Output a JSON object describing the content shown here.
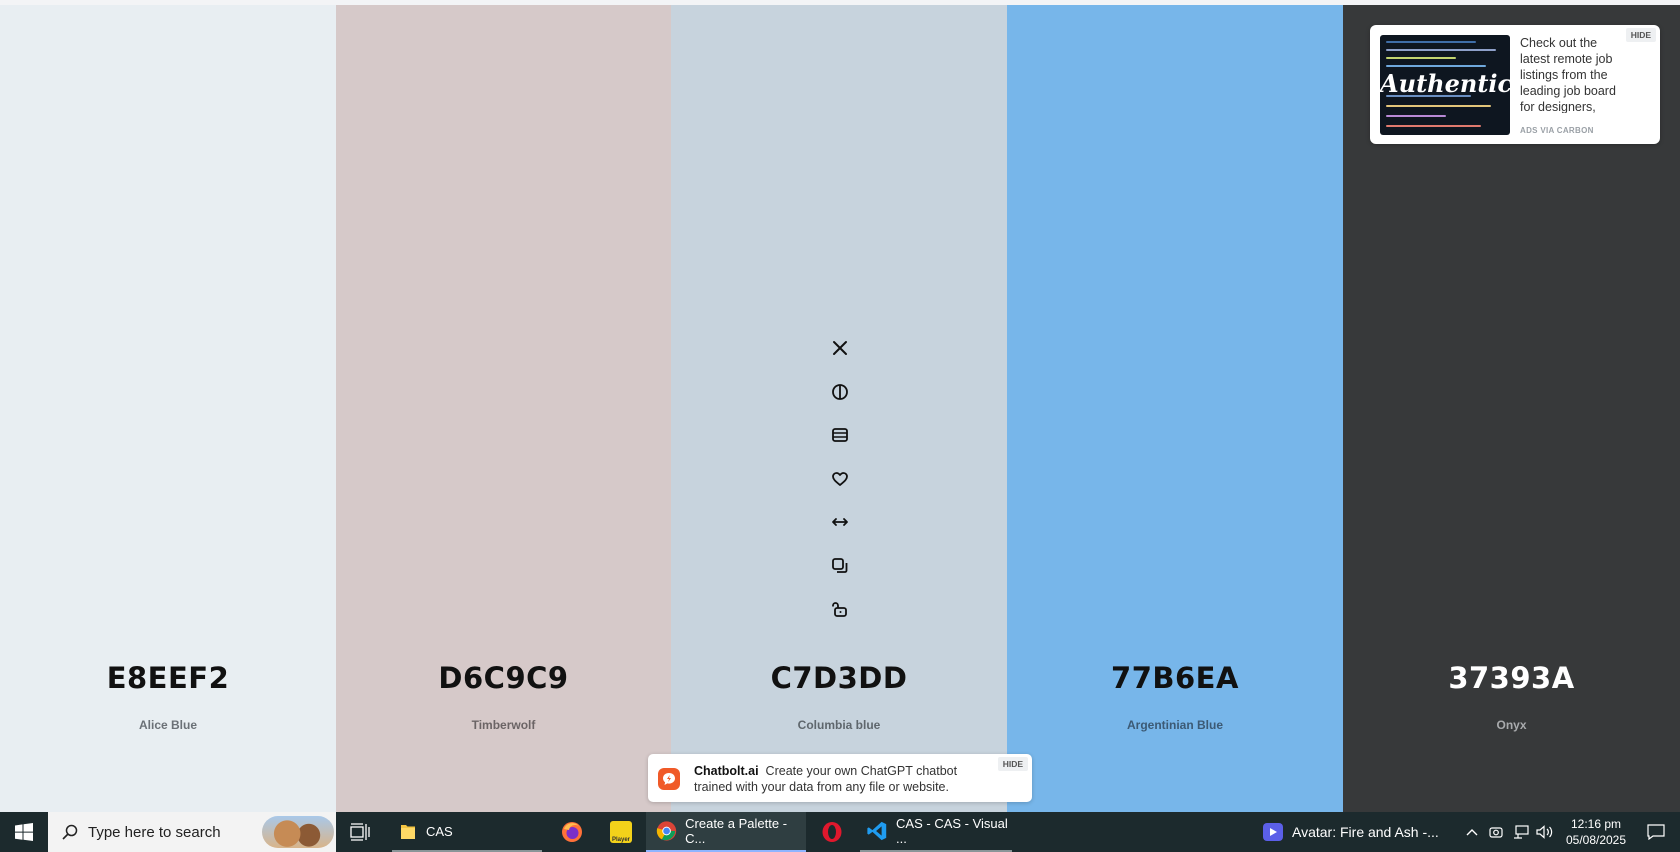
{
  "palette": {
    "colors": [
      {
        "hex": "E8EEF2",
        "name": "Alice Blue",
        "bg": "#E8EEF2",
        "text": "#111111",
        "name_color": "#6b7177"
      },
      {
        "hex": "D6C9C9",
        "name": "Timberwolf",
        "bg": "#D6C9C9",
        "text": "#111111",
        "name_color": "#6b6465"
      },
      {
        "hex": "C7D3DD",
        "name": "Columbia blue",
        "bg": "#C7D3DD",
        "text": "#111111",
        "name_color": "#5f676d"
      },
      {
        "hex": "77B6EA",
        "name": "Argentinian Blue",
        "bg": "#77B6EA",
        "text": "#111111",
        "name_color": "#3c5a75"
      },
      {
        "hex": "37393A",
        "name": "Onyx",
        "bg": "#37393A",
        "text": "#ffffff",
        "name_color": "#a9abad"
      }
    ],
    "column_tools": [
      "close-icon",
      "contrast-icon",
      "shades-icon",
      "heart-icon",
      "drag-arrows-icon",
      "copy-icon",
      "unlock-icon"
    ]
  },
  "ads": {
    "carbon": {
      "image_word": "Authentic",
      "text": "Check out the latest remote job listings from the leading job board for designers, developers, and creative pros.",
      "via": "ADS VIA CARBON",
      "hide": "HIDE"
    },
    "chatbolt": {
      "name": "Chatbolt.ai",
      "text": "Create your own ChatGPT chatbot trained with your data from any file or website.",
      "hide": "HIDE"
    }
  },
  "taskbar": {
    "search_placeholder": "Type here to search",
    "apps": [
      {
        "label": "CAS",
        "icon": "folder-icon"
      },
      {
        "label": "",
        "icon": "firefox-icon"
      },
      {
        "label": "Player",
        "icon": "player-icon"
      },
      {
        "label": "Create a Palette - C...",
        "icon": "chrome-icon"
      },
      {
        "label": "",
        "icon": "opera-icon"
      },
      {
        "label": "CAS - CAS - Visual ...",
        "icon": "vscode-icon"
      },
      {
        "label": "Avatar: Fire and Ash -...",
        "icon": "media-player-icon"
      }
    ],
    "time": "12:16 pm",
    "date": "05/08/2025"
  }
}
